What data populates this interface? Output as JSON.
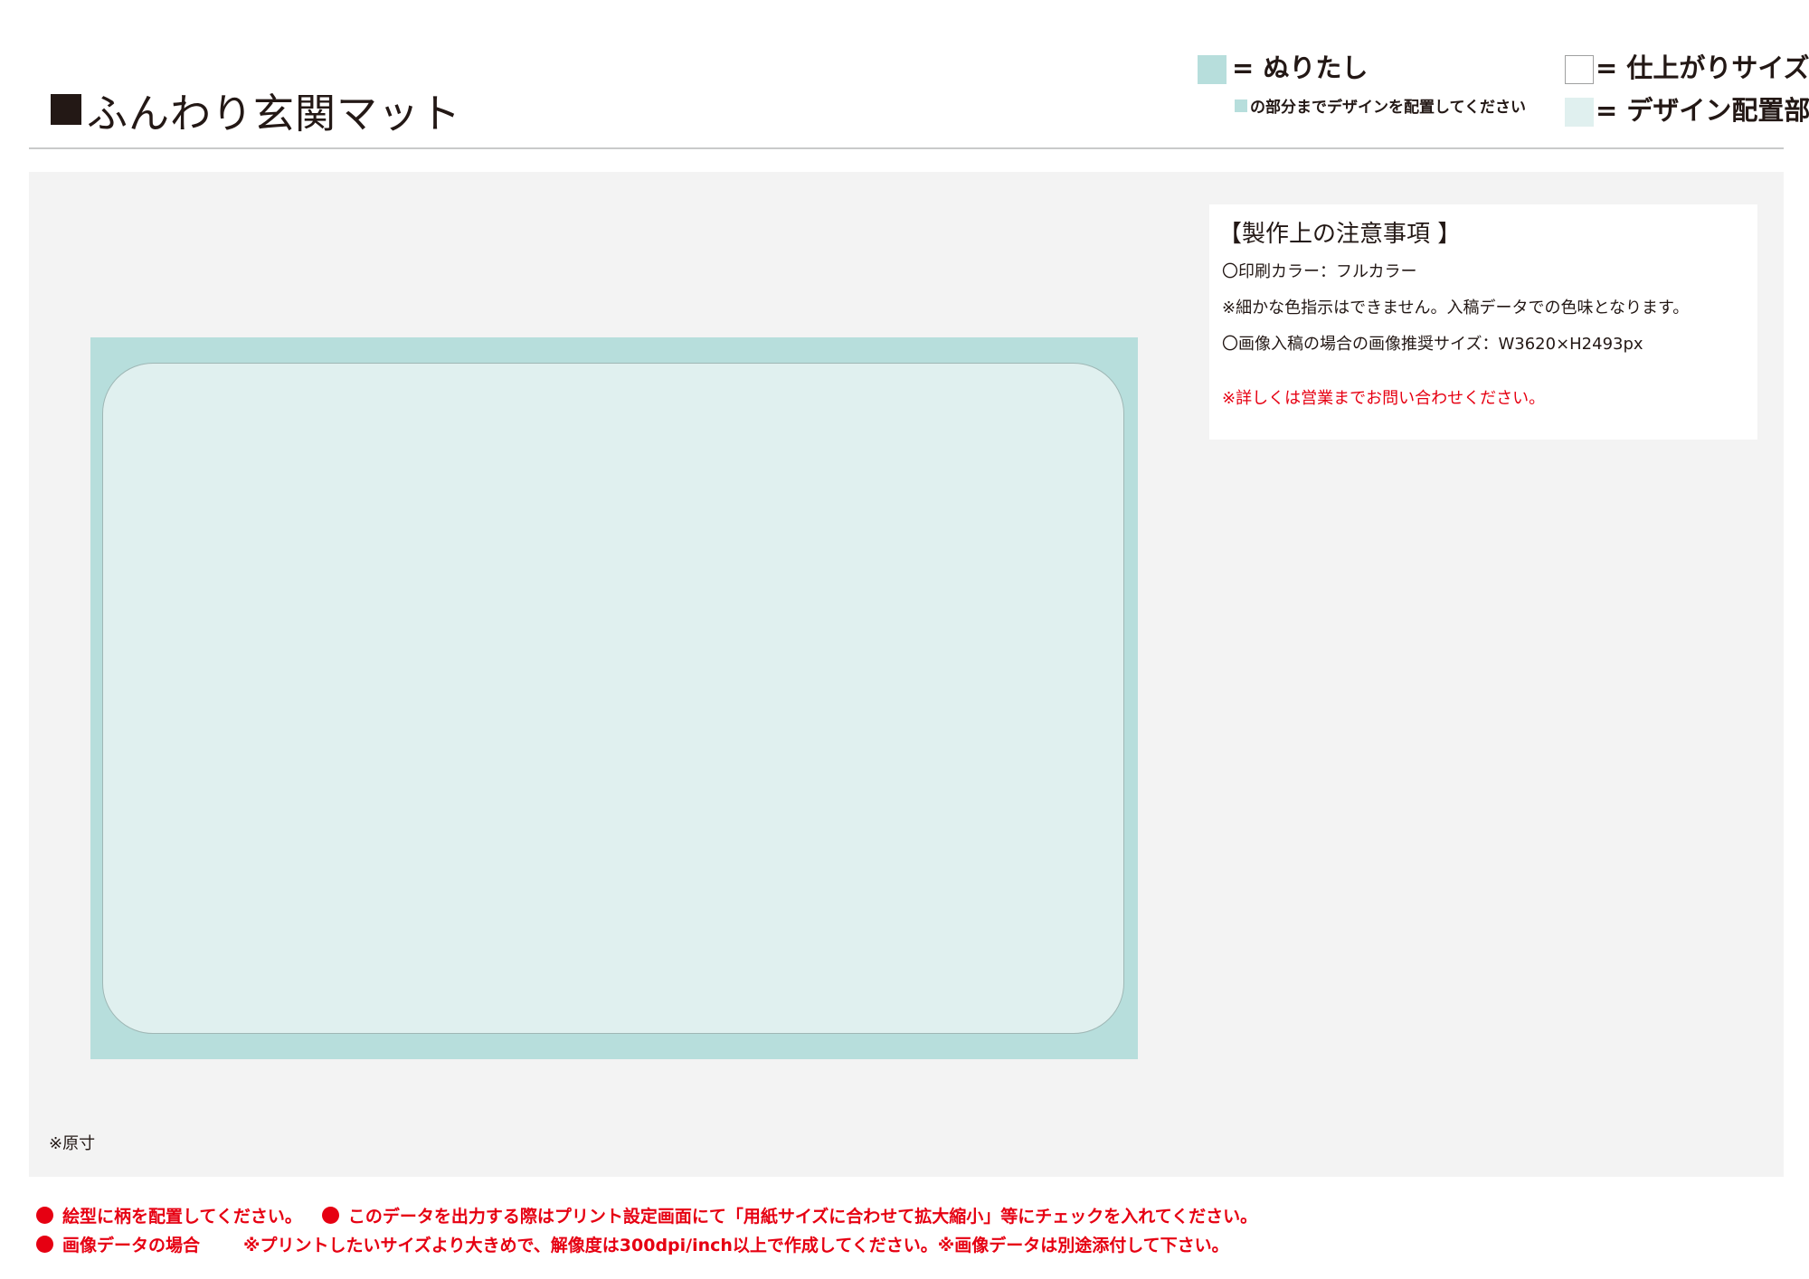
{
  "header": {
    "title": "ふんわり玄関マット"
  },
  "legend": {
    "bleed_label": "= ぬりたし",
    "bleed_note": "の部分までデザインを配置してください",
    "trim_label": "= 仕上がりサイズ",
    "design_label": "= デザイン配置部"
  },
  "colors": {
    "bleed": "#b7dedc",
    "design_area": "#e0f0ef",
    "trim": "#ffffff",
    "workspace": "#f3f3f3",
    "warning": "#e60012",
    "text": "#231815"
  },
  "notes": {
    "heading": "【製作上の注意事項 】",
    "line1": "〇印刷カラー：フルカラー",
    "line2": "※細かな色指示はできません。入稿データでの色味となります。",
    "line3": "〇画像入稿の場合の画像推奨サイズ：W3620×H2493px",
    "line4": "※詳しくは営業までお問い合わせください。"
  },
  "scale_note": "※原寸",
  "footer": {
    "item1": "絵型に柄を配置してください。",
    "item2": "このデータを出力する際はプリント設定画面にて「用紙サイズに合わせて拡大縮小」等にチェックを入れてください。",
    "item3": "画像データの場合",
    "item3_detail": "※プリントしたいサイズより大きめで、解像度は300dpi/inch以上で作成してください。※画像データは別途添付して下さい。"
  }
}
